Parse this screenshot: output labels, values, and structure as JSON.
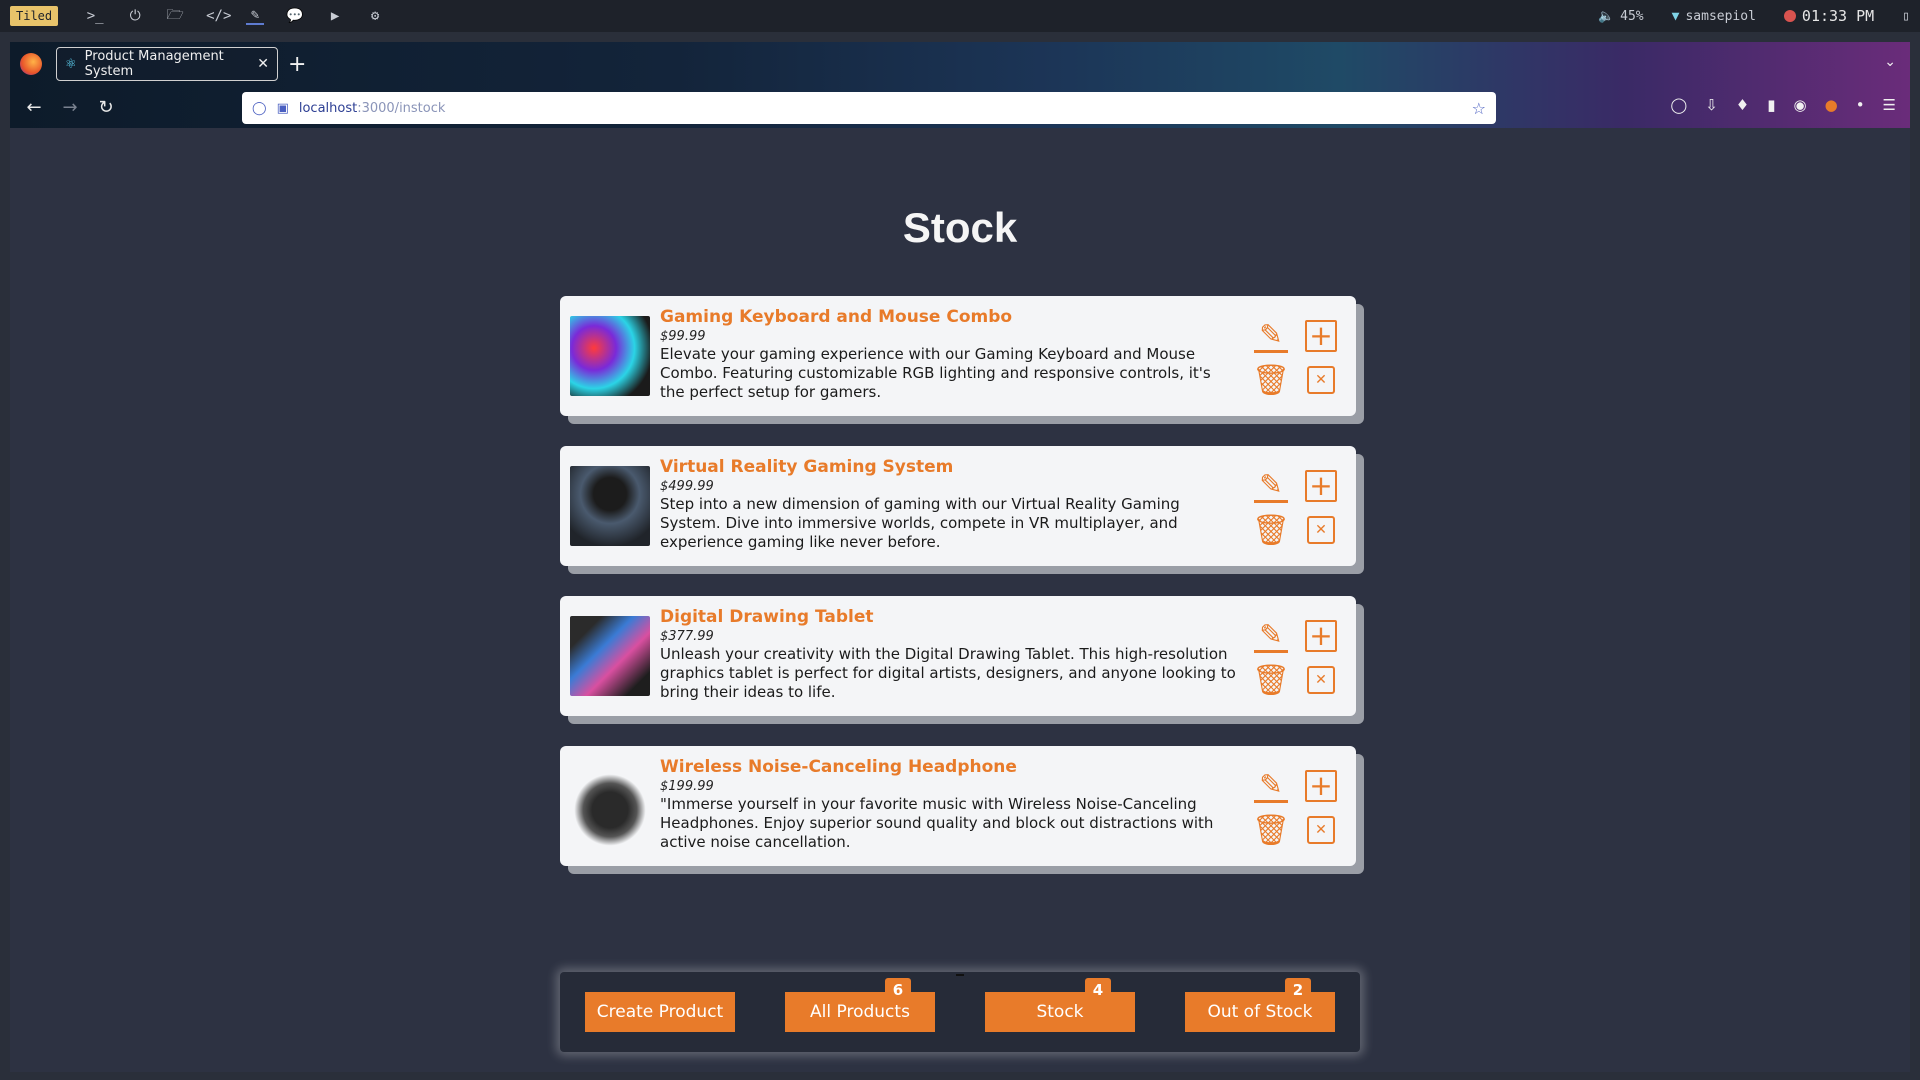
{
  "sysbar": {
    "mode_label": "Tiled",
    "volume": "45%",
    "wifi_name": "samsepiol",
    "clock": "01:33 PM",
    "icons": [
      "terminal-icon",
      "power-icon",
      "folder-icon",
      "code-icon",
      "notebook-icon",
      "chat-icon",
      "youtube-icon",
      "gear-icon"
    ]
  },
  "browser": {
    "tab_title": "Product Management System",
    "url_host": "localhost",
    "url_path": ":3000/instock"
  },
  "page": {
    "title": "Stock"
  },
  "products": [
    {
      "name": "Gaming Keyboard and Mouse Combo",
      "price": "$99.99",
      "description": "Elevate your gaming experience with our Gaming Keyboard and Mouse Combo. Featuring customizable RGB lighting and responsive controls, it's the perfect setup for gamers."
    },
    {
      "name": "Virtual Reality Gaming System",
      "price": "$499.99",
      "description": "Step into a new dimension of gaming with our Virtual Reality Gaming System. Dive into immersive worlds, compete in VR multiplayer, and experience gaming like never before."
    },
    {
      "name": "Digital Drawing Tablet",
      "price": "$377.99",
      "description": "Unleash your creativity with the Digital Drawing Tablet. This high-resolution graphics tablet is perfect for digital artists, designers, and anyone looking to bring their ideas to life."
    },
    {
      "name": "Wireless Noise-Canceling Headphone",
      "price": "$199.99",
      "description": "\"Immerse yourself in your favorite music with Wireless Noise-Canceling Headphones. Enjoy superior sound quality and block out distractions with active noise cancellation."
    }
  ],
  "bottom_nav": {
    "create_label": "Create Product",
    "all_label": "All Products",
    "all_count": "6",
    "stock_label": "Stock",
    "stock_count": "4",
    "out_label": "Out of Stock",
    "out_count": "2"
  },
  "colors": {
    "accent": "#e87b2a",
    "page_bg": "#2d3242",
    "card_bg": "#f4f5f7"
  }
}
